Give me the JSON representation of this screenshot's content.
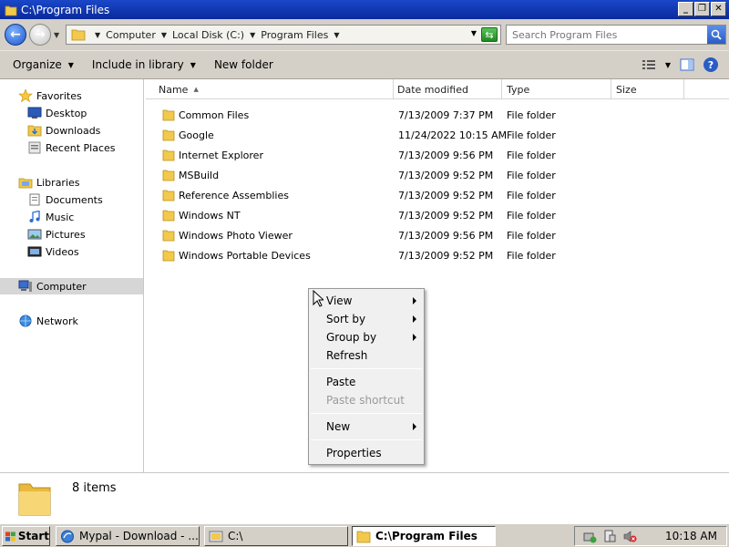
{
  "window": {
    "title": "C:\\Program Files"
  },
  "address": {
    "crumbs": [
      "Computer",
      "Local Disk (C:)",
      "Program Files"
    ]
  },
  "search": {
    "placeholder": "Search Program Files"
  },
  "toolbar": {
    "organize": "Organize",
    "include_in_library": "Include in library",
    "new_folder": "New folder"
  },
  "nav": {
    "favorites": "Favorites",
    "desktop": "Desktop",
    "downloads": "Downloads",
    "recent_places": "Recent Places",
    "libraries": "Libraries",
    "documents": "Documents",
    "music": "Music",
    "pictures": "Pictures",
    "videos": "Videos",
    "computer": "Computer",
    "network": "Network"
  },
  "columns": {
    "name": "Name",
    "date_modified": "Date modified",
    "type": "Type",
    "size": "Size"
  },
  "files": [
    {
      "name": "Common Files",
      "date": "7/13/2009 7:37 PM",
      "type": "File folder"
    },
    {
      "name": "Google",
      "date": "11/24/2022 10:15 AM",
      "type": "File folder"
    },
    {
      "name": "Internet Explorer",
      "date": "7/13/2009 9:56 PM",
      "type": "File folder"
    },
    {
      "name": "MSBuild",
      "date": "7/13/2009 9:52 PM",
      "type": "File folder"
    },
    {
      "name": "Reference Assemblies",
      "date": "7/13/2009 9:52 PM",
      "type": "File folder"
    },
    {
      "name": "Windows NT",
      "date": "7/13/2009 9:52 PM",
      "type": "File folder"
    },
    {
      "name": "Windows Photo Viewer",
      "date": "7/13/2009 9:56 PM",
      "type": "File folder"
    },
    {
      "name": "Windows Portable Devices",
      "date": "7/13/2009 9:52 PM",
      "type": "File folder"
    }
  ],
  "context_menu": {
    "view": "View",
    "sort_by": "Sort by",
    "group_by": "Group by",
    "refresh": "Refresh",
    "paste": "Paste",
    "paste_shortcut": "Paste shortcut",
    "new": "New",
    "properties": "Properties"
  },
  "details": {
    "item_count": "8 items"
  },
  "taskbar": {
    "start": "Start",
    "tasks": [
      "Mypal - Download - ...",
      "C:\\",
      "C:\\Program Files"
    ],
    "clock": "10:18 AM"
  },
  "colors": {
    "titlebar": "#0a2a9c",
    "chrome": "#d4d0c8",
    "folder": "#f2c94c"
  }
}
